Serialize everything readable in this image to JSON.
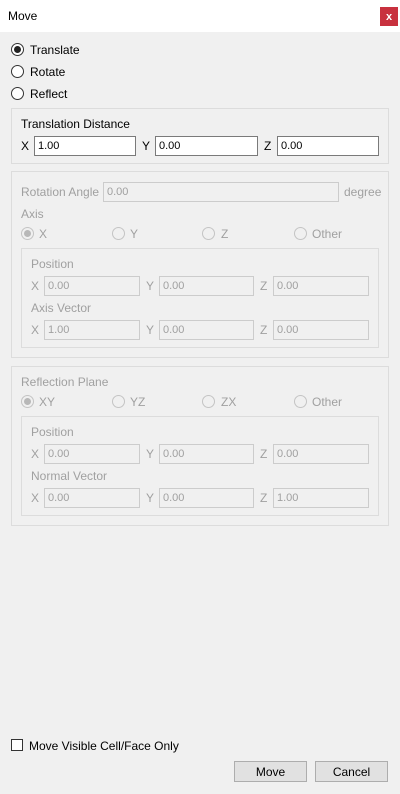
{
  "window": {
    "title": "Move",
    "close_label": "x"
  },
  "mode": {
    "translate_label": "Translate",
    "rotate_label": "Rotate",
    "reflect_label": "Reflect",
    "selected": "Translate"
  },
  "translation": {
    "title": "Translation Distance",
    "x_label": "X",
    "x_value": "1.00",
    "y_label": "Y",
    "y_value": "0.00",
    "z_label": "Z",
    "z_value": "0.00"
  },
  "rotation": {
    "angle_label": "Rotation Angle",
    "angle_value": "0.00",
    "angle_unit": "degree",
    "axis_label": "Axis",
    "axis_options": {
      "x": "X",
      "y": "Y",
      "z": "Z",
      "other": "Other"
    },
    "axis_selected": "X",
    "position_label": "Position",
    "position": {
      "x_label": "X",
      "x": "0.00",
      "y_label": "Y",
      "y": "0.00",
      "z_label": "Z",
      "z": "0.00"
    },
    "vector_label": "Axis Vector",
    "vector": {
      "x_label": "X",
      "x": "1.00",
      "y_label": "Y",
      "y": "0.00",
      "z_label": "Z",
      "z": "0.00"
    }
  },
  "reflection": {
    "plane_label": "Reflection Plane",
    "plane_options": {
      "xy": "XY",
      "yz": "YZ",
      "zx": "ZX",
      "other": "Other"
    },
    "plane_selected": "XY",
    "position_label": "Position",
    "position": {
      "x_label": "X",
      "x": "0.00",
      "y_label": "Y",
      "y": "0.00",
      "z_label": "Z",
      "z": "0.00"
    },
    "normal_label": "Normal Vector",
    "normal": {
      "x_label": "X",
      "x": "0.00",
      "y_label": "Y",
      "y": "0.00",
      "z_label": "Z",
      "z": "1.00"
    }
  },
  "footer": {
    "visible_only_label": "Move Visible Cell/Face Only",
    "visible_only_checked": false,
    "move_label": "Move",
    "cancel_label": "Cancel"
  }
}
